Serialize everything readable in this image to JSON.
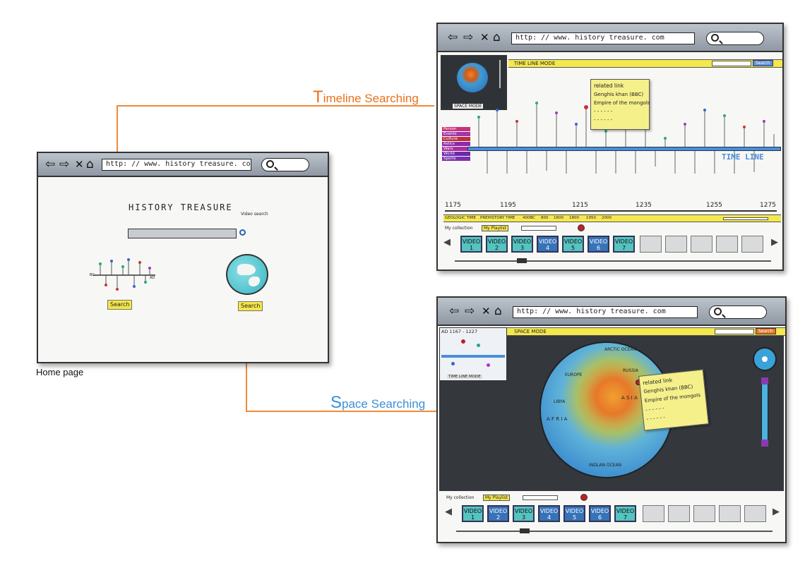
{
  "colors": {
    "connector": "#f08a3a",
    "timeline_title": "#e8711f",
    "space_title": "#3a8fd8",
    "highlight_yellow": "#f4e84f",
    "timeline_blue": "#4a8ed6",
    "video_teal": "#55c3c0",
    "video_blue": "#3673b8"
  },
  "labels": {
    "timeline_searching": {
      "initial": "T",
      "rest": "imeline Searching"
    },
    "space_searching": {
      "initial": "S",
      "rest": "pace Searching"
    },
    "home_page": "Home page"
  },
  "home": {
    "url": "http: // www. history treasure. com",
    "title": "HISTORY TREASURE",
    "subtitle": "Video search",
    "search_left": "Search",
    "search_right": "Search",
    "bc_label": "BC",
    "ad_label": "AD",
    "icons": [
      "back-arrow-icon",
      "forward-arrow-icon",
      "close-icon",
      "home-icon",
      "search-icon",
      "globe-icon"
    ]
  },
  "timeline": {
    "url": "http: // www. history treasure. com",
    "mode_label": "TIME LINE MODE",
    "search_btn": "Search",
    "space_mode_label": "SPACE MODE",
    "timeline_word": "TIME LINE",
    "years": [
      "1175",
      "1195",
      "1215",
      "1235",
      "1255",
      "1275"
    ],
    "eras": [
      "GEOLOGIC TIME",
      "PREHISTORY TIME",
      "400BC",
      "800",
      "1600",
      "1800",
      "1950",
      "2000"
    ],
    "categories": [
      "Person",
      "Events",
      "Culture",
      "Relics",
      "Wars",
      "World",
      "Sports"
    ],
    "popup": [
      "related link",
      "Genghis khan (BBC)",
      "Empire of the mongols",
      "- - - - - -",
      "- - - - - -"
    ],
    "my_collection": "My collection",
    "my_playlist": "My Playlist",
    "videos": [
      {
        "label": "VIDEO",
        "num": "1",
        "style": "teal"
      },
      {
        "label": "VIDEO",
        "num": "2",
        "style": "teal"
      },
      {
        "label": "VIDEO",
        "num": "3",
        "style": "teal"
      },
      {
        "label": "VIDEO",
        "num": "4",
        "style": "blue"
      },
      {
        "label": "VIDEO",
        "num": "5",
        "style": "teal"
      },
      {
        "label": "VIDEO",
        "num": "6",
        "style": "blue"
      },
      {
        "label": "VIDEO",
        "num": "7",
        "style": "teal"
      }
    ]
  },
  "space": {
    "url": "http: // www. history treasure. com",
    "mode_label": "SPACE MODE",
    "search_btn": "Search",
    "range_label": "AD 1167 - 1227",
    "timeline_mode_label": "TIME LINE MODE",
    "map_labels": {
      "arctic": "ARCTIC OCEAN",
      "europe": "EUROPE",
      "russia": "RUSSIA",
      "asia": "A S I A",
      "libya": "LIBYA",
      "africa": "A F R I A",
      "indian": "INDLAN OCEAN"
    },
    "popup": [
      "related link",
      "Genghis khan (BBC)",
      "Empire of the mongols",
      "- - - - - -",
      "- - - - - -"
    ],
    "my_collection": "My collection",
    "my_playlist": "My Playlist",
    "videos": [
      {
        "label": "VIDEO",
        "num": "1",
        "style": "teal"
      },
      {
        "label": "VIDEO",
        "num": "2",
        "style": "blue"
      },
      {
        "label": "VIDEO",
        "num": "3",
        "style": "teal"
      },
      {
        "label": "VIDEO",
        "num": "4",
        "style": "blue"
      },
      {
        "label": "VIDEO",
        "num": "5",
        "style": "blue"
      },
      {
        "label": "VIDEO",
        "num": "6",
        "style": "blue"
      },
      {
        "label": "VIDEO",
        "num": "7",
        "style": "teal"
      }
    ]
  }
}
